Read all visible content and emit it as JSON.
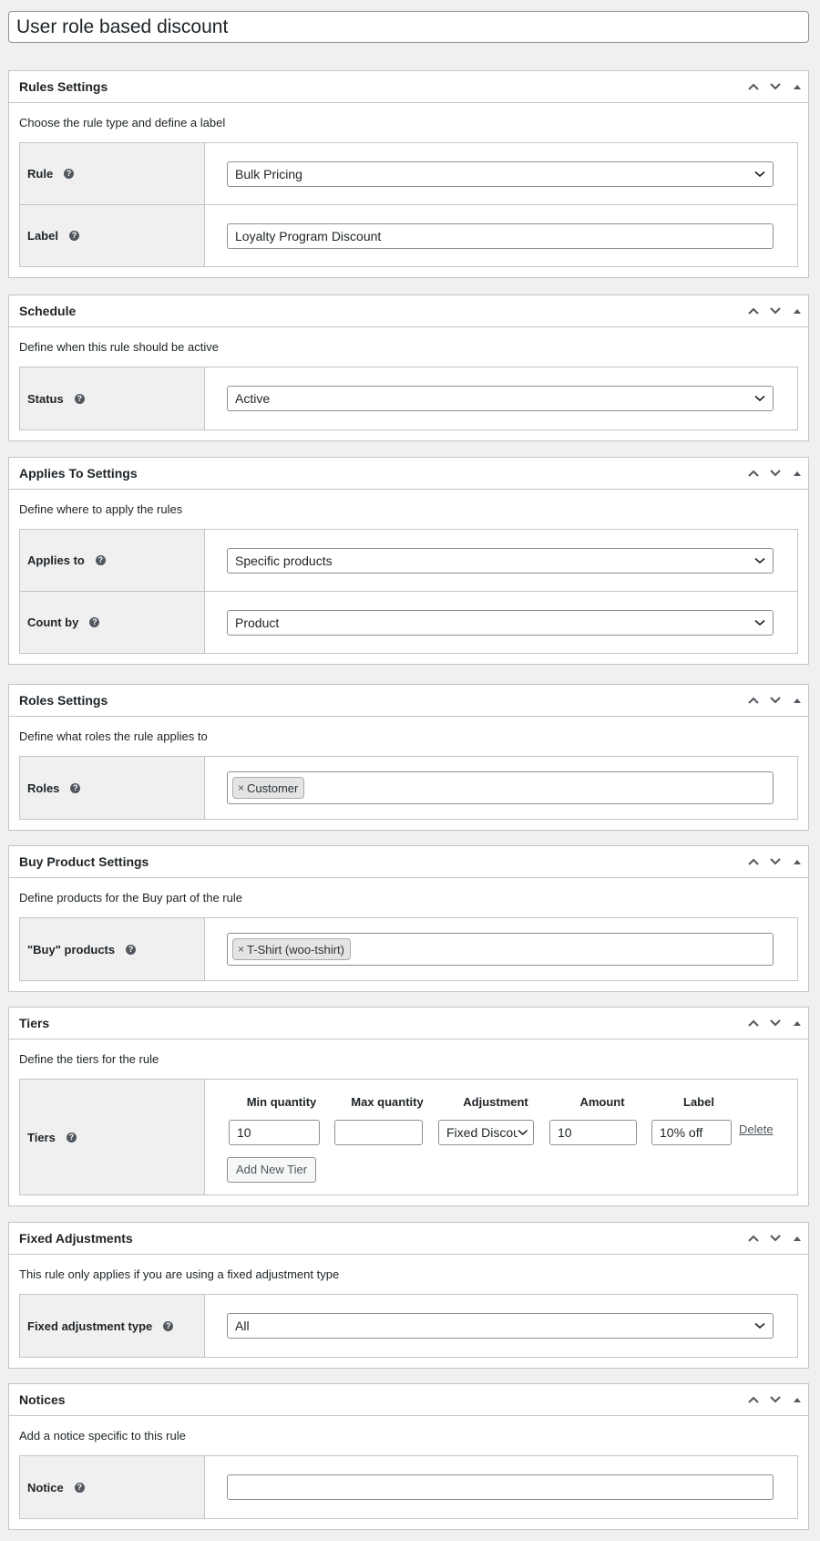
{
  "post_title": "User role based discount",
  "help_glyph": "?",
  "colors": {
    "border": "#c3c4c7",
    "label_bg": "#f0f0f1",
    "text": "#1d2327"
  },
  "boxes": {
    "rules": {
      "title": "Rules Settings",
      "description": "Choose the rule type and define a label",
      "rule_label": "Rule",
      "rule_value": "Bulk Pricing",
      "label_label": "Label",
      "label_value": "Loyalty Program Discount"
    },
    "schedule": {
      "title": "Schedule",
      "description": "Define when this rule should be active",
      "status_label": "Status",
      "status_value": "Active"
    },
    "applies": {
      "title": "Applies To Settings",
      "description": "Define where to apply the rules",
      "applies_label": "Applies to",
      "applies_value": "Specific products",
      "count_label": "Count by",
      "count_value": "Product"
    },
    "roles": {
      "title": "Roles Settings",
      "description": "Define what roles the rule applies to",
      "roles_label": "Roles",
      "tag_remove": "×",
      "tag": "Customer"
    },
    "buy": {
      "title": "Buy Product Settings",
      "description": "Define products for the Buy part of the rule",
      "buy_label": "\"Buy\" products",
      "tag_remove": "×",
      "tag": "T-Shirt (woo-tshirt)"
    },
    "tiers": {
      "title": "Tiers",
      "description": "Define the tiers for the rule",
      "tiers_label": "Tiers",
      "columns": [
        "Min quantity",
        "Max quantity",
        "Adjustment",
        "Amount",
        "Label"
      ],
      "row": {
        "min": "10",
        "max": "",
        "adjustment": "Fixed Discou",
        "amount": "10",
        "label": "10% off",
        "delete": "Delete"
      },
      "add_button": "Add New Tier"
    },
    "fixed": {
      "title": "Fixed Adjustments",
      "description": "This rule only applies if you are using a fixed adjustment type",
      "type_label": "Fixed adjustment type",
      "type_value": "All"
    },
    "notices": {
      "title": "Notices",
      "description": "Add a notice specific to this rule",
      "notice_label": "Notice",
      "notice_value": ""
    }
  }
}
